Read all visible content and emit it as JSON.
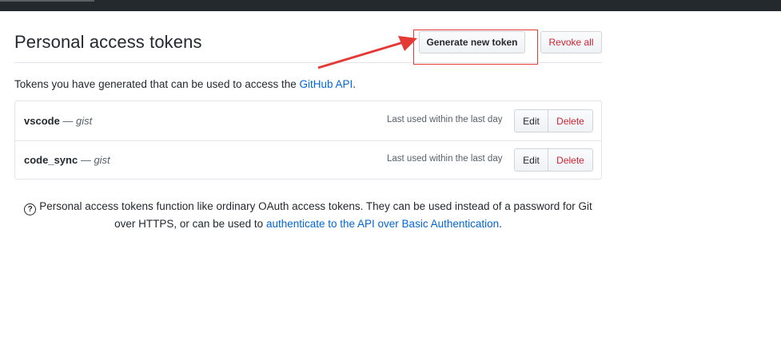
{
  "header": {
    "title": "Personal access tokens"
  },
  "actions": {
    "generate_label": "Generate new token",
    "revoke_label": "Revoke all"
  },
  "intro": {
    "text": "Tokens you have generated that can be used to access the ",
    "link": "GitHub API",
    "suffix": "."
  },
  "tokens": [
    {
      "name": "vscode",
      "separator": " — ",
      "scope": "gist",
      "last_used": "Last used within the last day",
      "edit_label": "Edit",
      "delete_label": "Delete"
    },
    {
      "name": "code_sync",
      "separator": " — ",
      "scope": "gist",
      "last_used": "Last used within the last day",
      "edit_label": "Edit",
      "delete_label": "Delete"
    }
  ],
  "note": {
    "icon": "question-circle-icon",
    "text": "Personal access tokens function like ordinary OAuth access tokens. They can be used instead of a password for Git over HTTPS, or can be used to ",
    "link": "authenticate to the API over Basic Authentication",
    "suffix": "."
  },
  "colors": {
    "link": "#0366d6",
    "danger": "#cb2431",
    "annotation": "#e53935",
    "topbar": "#24292e"
  }
}
